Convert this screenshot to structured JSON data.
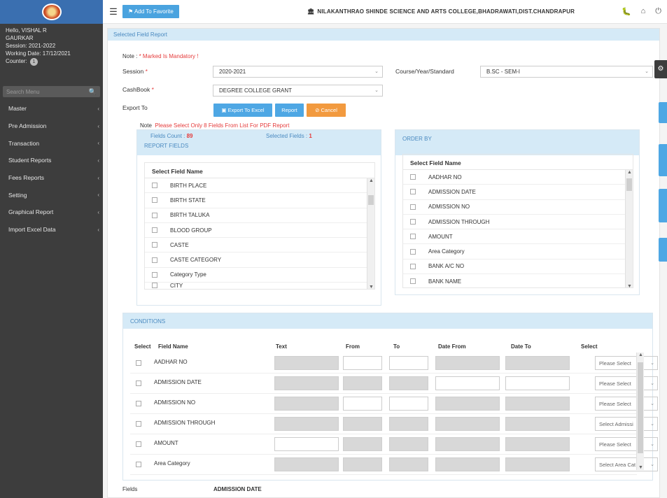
{
  "sidebar": {
    "user_greeting": "Hello, VISHAL R",
    "user_surname": "GAURKAR",
    "session": "Session: 2021-2022",
    "working_date": "Working Date: 17/12/2021",
    "counter_label": "Counter:",
    "counter_value": "1",
    "search_placeholder": "Search Menu",
    "menu": [
      "Master",
      "Pre Admission",
      "Transaction",
      "Student Reports",
      "Fees Reports",
      "Setting",
      "Graphical Report",
      "Import Excel Data"
    ]
  },
  "topbar": {
    "add_favorite": "Add To Favorite",
    "college_name": "NILAKANTHRAO SHINDE SCIENCE AND ARTS COLLEGE,BHADRAWATI,DIST.CHANDRAPUR"
  },
  "panel_title": "Selected Field Report",
  "note_prefix": "Note : ",
  "note_mandatory": "* Marked Is Mandatory !",
  "form": {
    "session_label": "Session",
    "session_value": "2020-2021",
    "course_label": "Course/Year/Standard",
    "course_value": "B.SC - SEM-I",
    "cashbook_label": "CashBook",
    "cashbook_value": "DEGREE COLLEGE GRANT",
    "export_label": "Export To"
  },
  "buttons": {
    "export_excel": "Export To Excel",
    "report": "Report",
    "cancel": "Cancel"
  },
  "pdf_note_prefix": "Note",
  "pdf_note": "Please Select Only 8 Fields From List For PDF Report",
  "report_fields": {
    "count_label": "Fields Count :",
    "count_value": "89",
    "selected_label": "Selected Fields :",
    "selected_value": "1",
    "title": "REPORT FIELDS",
    "column": "Select Field Name",
    "rows": [
      "BIRTH PLACE",
      "BIRTH STATE",
      "BIRTH TALUKA",
      "BLOOD GROUP",
      "CASTE",
      "CASTE CATEGORY",
      "Category Type",
      "CITY"
    ]
  },
  "order_by": {
    "title": "ORDER BY",
    "column": "Select Field Name",
    "rows": [
      "AADHAR NO",
      "ADMISSION DATE",
      "ADMISSION NO",
      "ADMISSION THROUGH",
      "AMOUNT",
      "Area Category",
      "BANK A/C NO",
      "BANK NAME"
    ]
  },
  "conditions": {
    "title": "CONDITIONS",
    "headers": [
      "Select",
      "Field Name",
      "Text",
      "From",
      "To",
      "Date From",
      "Date To",
      "Select"
    ],
    "rows": [
      {
        "name": "AADHAR NO",
        "select": "Please Select"
      },
      {
        "name": "ADMISSION DATE",
        "select": "Please Select"
      },
      {
        "name": "ADMISSION NO",
        "select": "Please Select"
      },
      {
        "name": "ADMISSION THROUGH",
        "select": "Select Admissi"
      },
      {
        "name": "AMOUNT",
        "select": "Please Select"
      },
      {
        "name": "Area Category",
        "select": "Select Area Cat"
      }
    ]
  },
  "bottom": {
    "fields_label": "Fields",
    "fields_value": "ADMISSION DATE"
  },
  "colors": {
    "sidebar_bg": "#3d3d3d",
    "accent_blue": "#4ea7e4",
    "cancel_orange": "#f29a3f",
    "mandatory_red": "#e53b3b",
    "panel_header": "#d5eaf7"
  }
}
